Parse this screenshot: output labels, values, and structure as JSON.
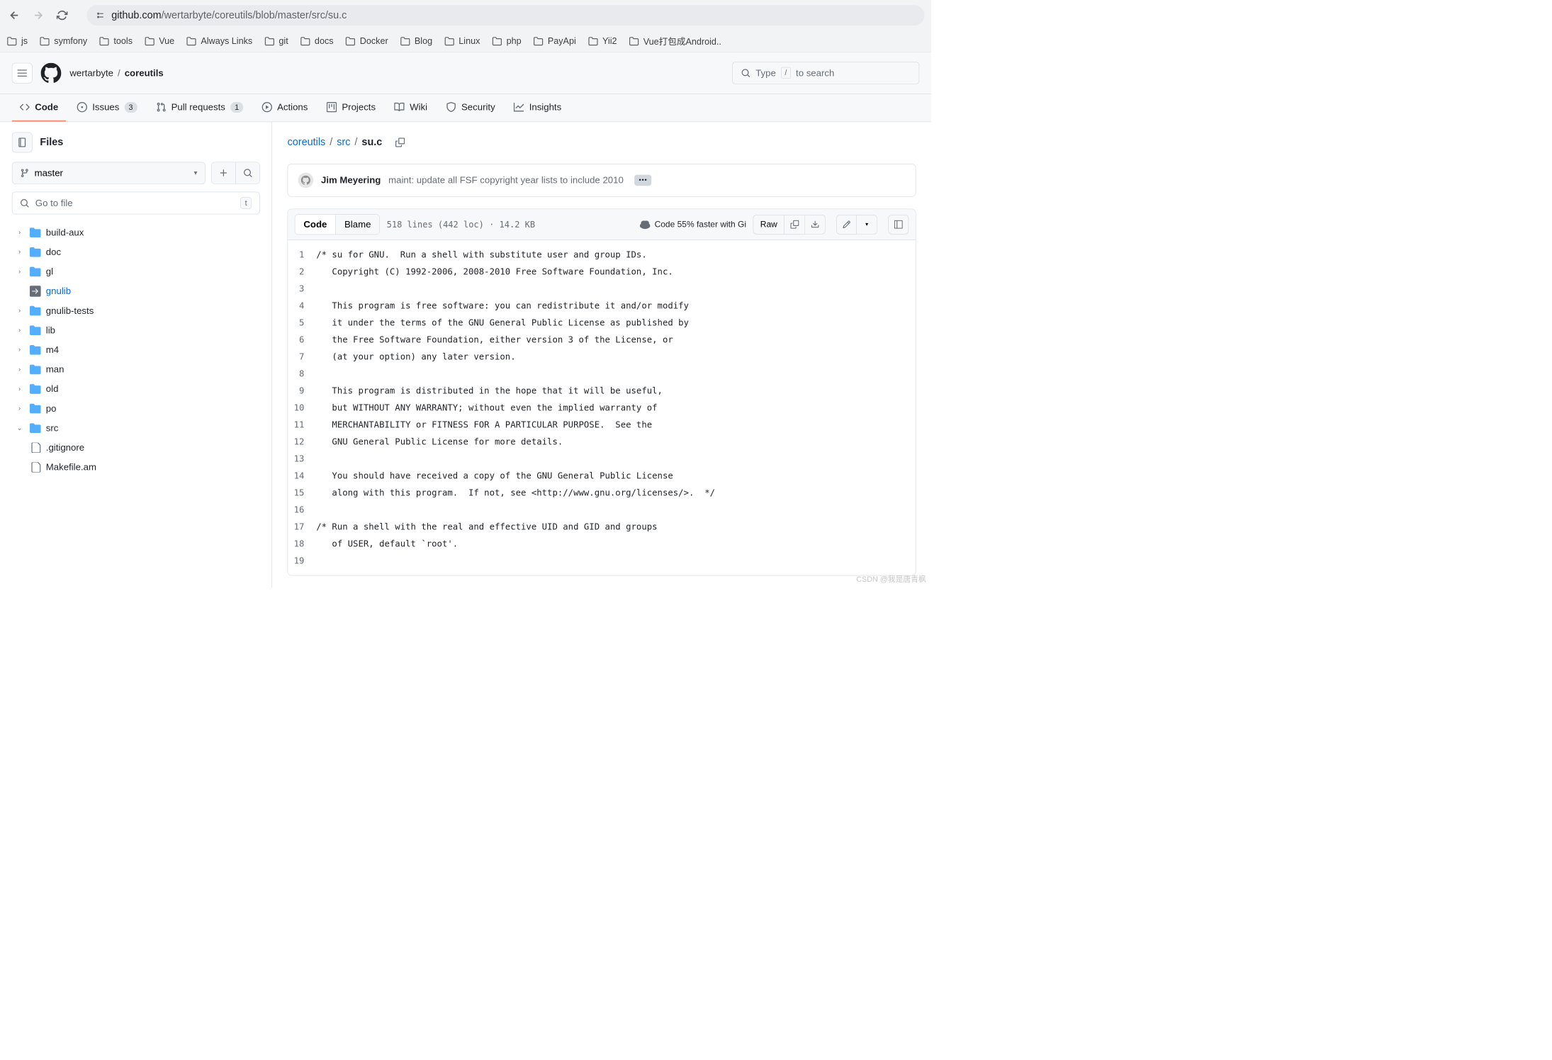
{
  "browser": {
    "url_host": "github.com",
    "url_path": "/wertarbyte/coreutils/blob/master/src/su.c",
    "bookmarks": [
      "js",
      "symfony",
      "tools",
      "Vue",
      "Always Links",
      "git",
      "docs",
      "Docker",
      "Blog",
      "Linux",
      "php",
      "PayApi",
      "Yii2",
      "Vue打包成Android.."
    ]
  },
  "repo": {
    "owner": "wertarbyte",
    "name": "coreutils",
    "search_placeholder": "Type",
    "search_hint": "to search",
    "tabs": {
      "code": "Code",
      "issues": "Issues",
      "issues_count": "3",
      "pulls": "Pull requests",
      "pulls_count": "1",
      "actions": "Actions",
      "projects": "Projects",
      "wiki": "Wiki",
      "security": "Security",
      "insights": "Insights"
    }
  },
  "sidebar": {
    "title": "Files",
    "branch": "master",
    "filter_placeholder": "Go to file",
    "filter_key": "t",
    "tree": [
      {
        "name": "build-aux",
        "type": "dir"
      },
      {
        "name": "doc",
        "type": "dir"
      },
      {
        "name": "gl",
        "type": "dir"
      },
      {
        "name": "gnulib",
        "type": "symlink"
      },
      {
        "name": "gnulib-tests",
        "type": "dir"
      },
      {
        "name": "lib",
        "type": "dir"
      },
      {
        "name": "m4",
        "type": "dir"
      },
      {
        "name": "man",
        "type": "dir"
      },
      {
        "name": "old",
        "type": "dir"
      },
      {
        "name": "po",
        "type": "dir"
      },
      {
        "name": "src",
        "type": "dir",
        "expanded": true,
        "children": [
          {
            "name": ".gitignore",
            "type": "file"
          },
          {
            "name": "Makefile.am",
            "type": "file"
          }
        ]
      }
    ]
  },
  "breadcrumb": {
    "root": "coreutils",
    "dir": "src",
    "file": "su.c"
  },
  "commit": {
    "author": "Jim Meyering",
    "message": "maint: update all FSF copyright year lists to include 2010",
    "more": "•••"
  },
  "codebar": {
    "code": "Code",
    "blame": "Blame",
    "lines": "518 lines (442 loc) · 14.2 KB",
    "copilot": "Code 55% faster with Gi",
    "raw": "Raw"
  },
  "source_lines": [
    "/* su for GNU.  Run a shell with substitute user and group IDs.",
    "   Copyright (C) 1992-2006, 2008-2010 Free Software Foundation, Inc.",
    "",
    "   This program is free software: you can redistribute it and/or modify",
    "   it under the terms of the GNU General Public License as published by",
    "   the Free Software Foundation, either version 3 of the License, or",
    "   (at your option) any later version.",
    "",
    "   This program is distributed in the hope that it will be useful,",
    "   but WITHOUT ANY WARRANTY; without even the implied warranty of",
    "   MERCHANTABILITY or FITNESS FOR A PARTICULAR PURPOSE.  See the",
    "   GNU General Public License for more details.",
    "",
    "   You should have received a copy of the GNU General Public License",
    "   along with this program.  If not, see <http://www.gnu.org/licenses/>.  */",
    "",
    "/* Run a shell with the real and effective UID and GID and groups",
    "   of USER, default `root'.",
    ""
  ],
  "watermark": "CSDN @我是唐青枫"
}
